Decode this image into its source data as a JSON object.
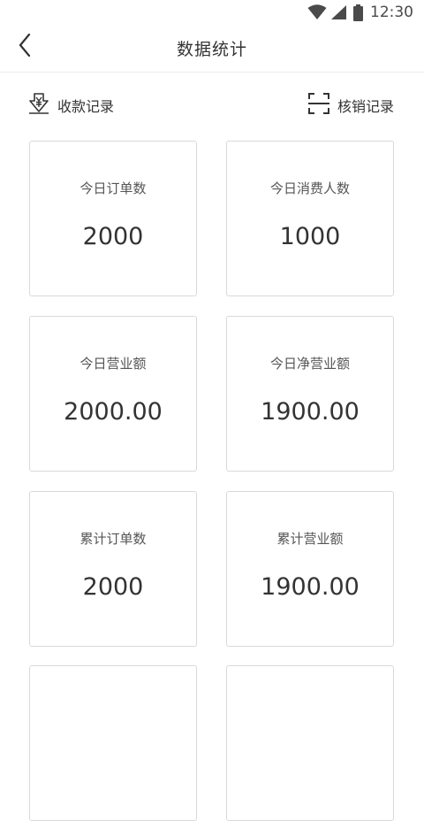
{
  "status_bar": {
    "time": "12:30",
    "icons": [
      "wifi-icon",
      "signal-icon",
      "battery-icon"
    ]
  },
  "header": {
    "back_icon": "chevron-left-icon",
    "title": "数据统计"
  },
  "quick_links": {
    "collection": {
      "icon": "yen-download-icon",
      "label": "收款记录"
    },
    "verification": {
      "icon": "scan-icon",
      "label": "核销记录"
    }
  },
  "stats": [
    {
      "label": "今日订单数",
      "value": "2000"
    },
    {
      "label": "今日消费人数",
      "value": "1000"
    },
    {
      "label": "今日营业额",
      "value": "2000.00"
    },
    {
      "label": "今日净营业额",
      "value": "1900.00"
    },
    {
      "label": "累计订单数",
      "value": "2000"
    },
    {
      "label": "累计营业额",
      "value": "1900.00"
    }
  ],
  "colors": {
    "text_primary": "#333333",
    "text_secondary": "#555555",
    "card_border": "#d9d9d9",
    "divider": "#ececec",
    "background": "#ffffff"
  }
}
